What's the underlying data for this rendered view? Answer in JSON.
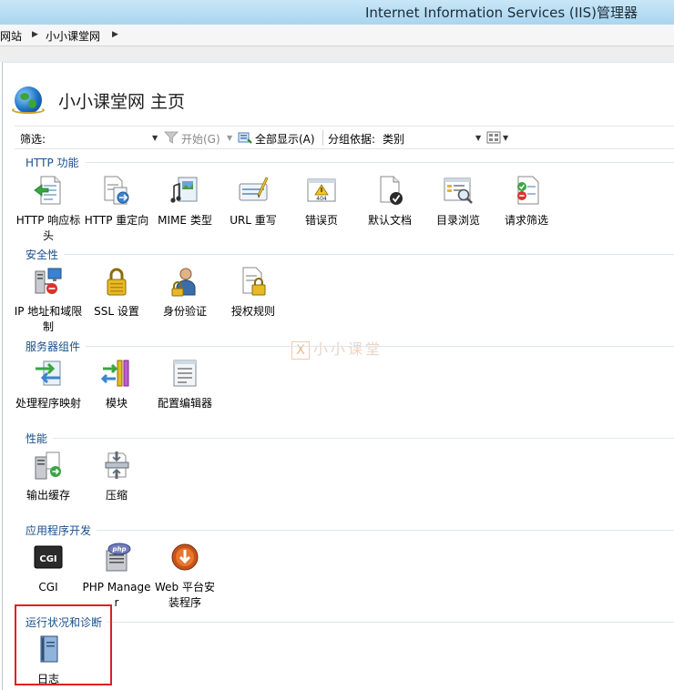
{
  "window": {
    "title": "Internet Information Services (IIS)管理器"
  },
  "breadcrumb": [
    "网站",
    "小小课堂网"
  ],
  "page": {
    "title": "小小课堂网 主页"
  },
  "toolbar": {
    "filter_label": "筛选:",
    "start_label": "开始(G)",
    "show_all_label": "全部显示(A)",
    "group_by_label": "分组依据:",
    "group_by_value": "类别"
  },
  "watermark": {
    "mark": "X",
    "text": "小小课堂"
  },
  "groups": [
    {
      "title": "HTTP 功能",
      "items": [
        {
          "label": "HTTP 响应标头",
          "icon": "http-response-headers-icon"
        },
        {
          "label": "HTTP 重定向",
          "icon": "http-redirect-icon"
        },
        {
          "label": "MIME 类型",
          "icon": "mime-types-icon"
        },
        {
          "label": "URL 重写",
          "icon": "url-rewrite-icon"
        },
        {
          "label": "错误页",
          "icon": "error-pages-icon"
        },
        {
          "label": "默认文档",
          "icon": "default-document-icon"
        },
        {
          "label": "目录浏览",
          "icon": "directory-browsing-icon"
        },
        {
          "label": "请求筛选",
          "icon": "request-filtering-icon"
        }
      ]
    },
    {
      "title": "安全性",
      "items": [
        {
          "label": "IP 地址和域限制",
          "icon": "ip-domain-restrictions-icon"
        },
        {
          "label": "SSL 设置",
          "icon": "ssl-settings-icon"
        },
        {
          "label": "身份验证",
          "icon": "authentication-icon"
        },
        {
          "label": "授权规则",
          "icon": "authorization-rules-icon"
        }
      ]
    },
    {
      "title": "服务器组件",
      "items": [
        {
          "label": "处理程序映射",
          "icon": "handler-mappings-icon"
        },
        {
          "label": "模块",
          "icon": "modules-icon"
        },
        {
          "label": "配置编辑器",
          "icon": "configuration-editor-icon"
        }
      ]
    },
    {
      "title": "性能",
      "items": [
        {
          "label": "输出缓存",
          "icon": "output-caching-icon"
        },
        {
          "label": "压缩",
          "icon": "compression-icon"
        }
      ]
    },
    {
      "title": "应用程序开发",
      "items": [
        {
          "label": "CGI",
          "icon": "cgi-icon"
        },
        {
          "label": "PHP Manager",
          "icon": "php-manager-icon"
        },
        {
          "label": "Web 平台安装程序",
          "icon": "web-platform-installer-icon"
        }
      ]
    },
    {
      "title": "运行状况和诊断",
      "items": [
        {
          "label": "日志",
          "icon": "logging-icon"
        }
      ]
    }
  ]
}
